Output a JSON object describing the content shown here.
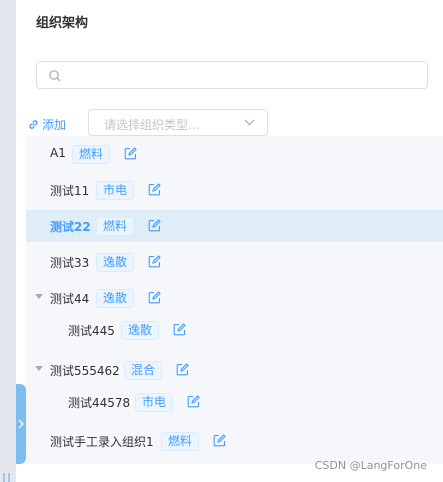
{
  "panel": {
    "title": "组织架构",
    "search": {
      "placeholder": ""
    },
    "add_label": "添加",
    "type_select": {
      "placeholder": "请选择组织类型..."
    }
  },
  "tree": {
    "nodes": [
      {
        "label": "A1",
        "tag": "燃料",
        "selected": false,
        "expanded": null
      },
      {
        "label": "测试11",
        "tag": "市电",
        "selected": false,
        "expanded": null
      },
      {
        "label": "测试22",
        "tag": "燃料",
        "selected": true,
        "expanded": null
      },
      {
        "label": "测试33",
        "tag": "逸散",
        "selected": false,
        "expanded": null
      },
      {
        "label": "测试44",
        "tag": "逸散",
        "selected": false,
        "expanded": true
      },
      {
        "label": "测试445",
        "tag": "逸散",
        "selected": false,
        "expanded": null
      },
      {
        "label": "测试555462",
        "tag": "混合",
        "selected": false,
        "expanded": true
      },
      {
        "label": "测试44578",
        "tag": "市电",
        "selected": false,
        "expanded": null
      },
      {
        "label": "测试手工录入组织1",
        "tag": "燃料",
        "selected": false,
        "expanded": null
      }
    ]
  },
  "watermark": "CSDN @LangForOne",
  "colors": {
    "accent": "#409eff",
    "selected_bg": "#dfedf7",
    "tag_bg": "#ecf5ff"
  },
  "icons": {
    "search": "search-icon",
    "add": "link-icon",
    "edit": "edit-icon",
    "select": "chevron-down-icon",
    "collapse": "chevron-right-icon"
  }
}
